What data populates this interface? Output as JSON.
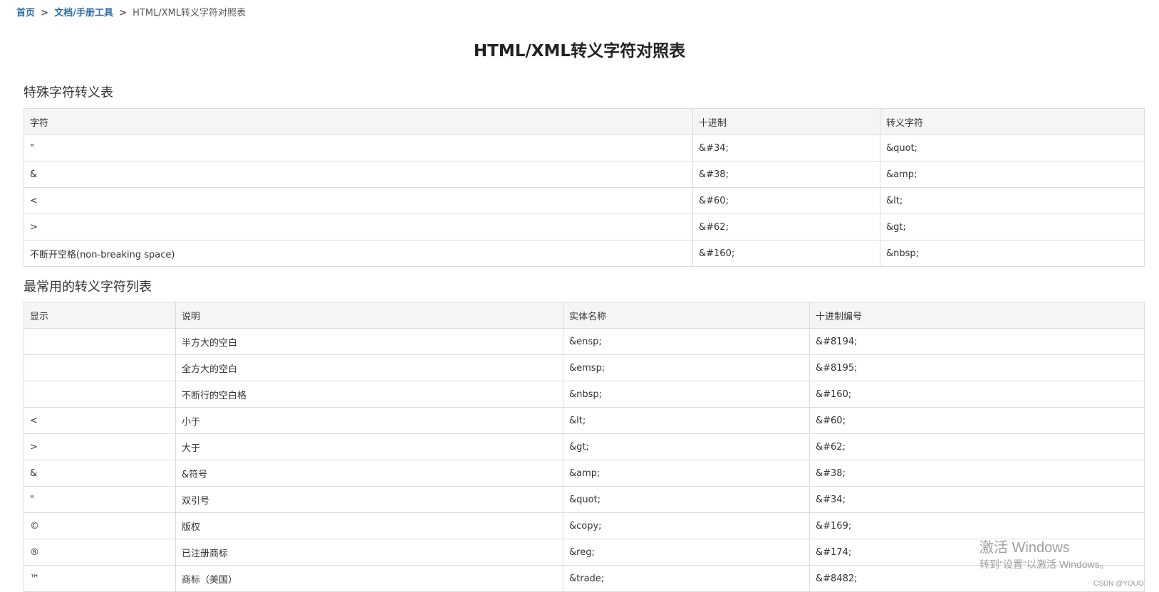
{
  "breadcrumb": {
    "home": "首页",
    "section": "文档/手册工具",
    "current": "HTML/XML转义字符对照表",
    "separator": ">"
  },
  "title": "HTML/XML转义字符对照表",
  "special_table": {
    "heading": "特殊字符转义表",
    "columns": [
      "字符",
      "十进制",
      "转义字符"
    ],
    "rows": [
      [
        "\"",
        "&#34;",
        "&quot;"
      ],
      [
        "&",
        "&#38;",
        "&amp;"
      ],
      [
        "<",
        "&#60;",
        "&lt;"
      ],
      [
        ">",
        "&#62;",
        "&gt;"
      ],
      [
        "不断开空格(non-breaking space)",
        "&#160;",
        "&nbsp;"
      ]
    ]
  },
  "common_table": {
    "heading": "最常用的转义字符列表",
    "columns": [
      "显示",
      "说明",
      "实体名称",
      "十进制编号"
    ],
    "rows": [
      [
        "",
        "半方大的空白",
        "&ensp;",
        "&#8194;"
      ],
      [
        "",
        "全方大的空白",
        "&emsp;",
        "&#8195;"
      ],
      [
        "",
        "不断行的空白格",
        "&nbsp;",
        "&#160;"
      ],
      [
        "<",
        "小于",
        "&lt;",
        "&#60;"
      ],
      [
        ">",
        "大于",
        "&gt;",
        "&#62;"
      ],
      [
        "&",
        "&符号",
        "&amp;",
        "&#38;"
      ],
      [
        "\"",
        "双引号",
        "&quot;",
        "&#34;"
      ],
      [
        "©",
        "版权",
        "&copy;",
        "&#169;"
      ],
      [
        "®",
        "已注册商标",
        "&reg;",
        "&#174;"
      ],
      [
        "™",
        "商标（美国）",
        "&trade;",
        "&#8482;"
      ]
    ]
  },
  "watermark": {
    "line1": "激活 Windows",
    "line2": "转到\"设置\"以激活 Windows。"
  },
  "csdn_mark": "CSDN @YOUO`"
}
